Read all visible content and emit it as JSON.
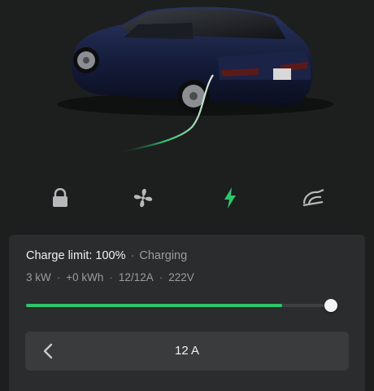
{
  "car": {
    "image_name": "car-rear-three-quarter-image"
  },
  "tabs": [
    {
      "id": "lock",
      "icon": "lock-icon",
      "active": false
    },
    {
      "id": "climate",
      "icon": "fan-icon",
      "active": false
    },
    {
      "id": "charging",
      "icon": "lightning-bolt-icon",
      "active": true
    },
    {
      "id": "wipers",
      "icon": "wiper-icon",
      "active": false
    }
  ],
  "charging": {
    "limit_label": "Charge limit: 100%",
    "status": "Charging",
    "power": "3 kW",
    "energy_added": "+0 kWh",
    "current": "12/12A",
    "voltage": "222V",
    "charge_limit_percent": 100,
    "battery_level_percent": 84,
    "amperage_value": "12 A"
  },
  "colors": {
    "background": "#1d1e1e",
    "panel": "#2b2c2d",
    "accent_green": "#2ec66c",
    "icon_inactive": "#b8b9ba"
  }
}
